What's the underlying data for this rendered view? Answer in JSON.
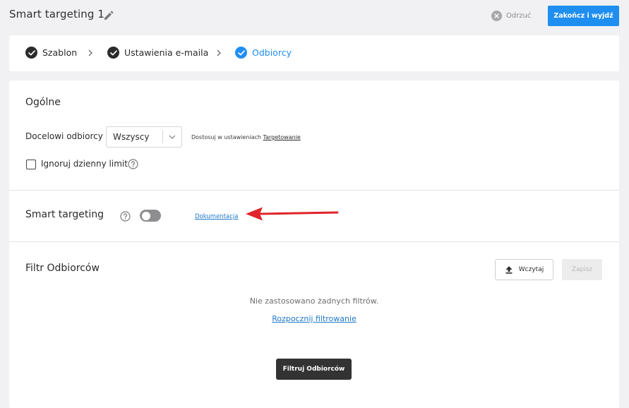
{
  "header": {
    "title": "Smart targeting 1",
    "discard_label": "Odrzuć",
    "finish_label": "Zakończ i wyjdź"
  },
  "steps": [
    {
      "label": "Szablon",
      "status": "done"
    },
    {
      "label": "Ustawienia e-maila",
      "status": "done"
    },
    {
      "label": "Odbiorcy",
      "status": "active"
    }
  ],
  "general": {
    "title": "Ogólne",
    "target_label": "Docelowi odbiorcy",
    "target_value": "Wszyscy",
    "hint_prefix": "Dostosuj w ustawieniach",
    "hint_link": "Targetowanie",
    "ignore_limit_label": "Ignoruj dzienny limit",
    "ignore_limit_checked": false
  },
  "smart_targeting": {
    "title": "Smart targeting",
    "enabled": false,
    "doc_link": "Dokumentacja"
  },
  "filter": {
    "title": "Filtr Odbiorców",
    "load_label": "Wczytaj",
    "save_label": "Zapisz",
    "empty_message": "Nie zastosowano żadnych filtrów.",
    "start_link": "Rozpocznij filtrowanie",
    "filter_button": "Filtruj Odbiorców"
  },
  "colors": {
    "accent": "#1f8ef1",
    "annotation_arrow": "#e0232b"
  }
}
